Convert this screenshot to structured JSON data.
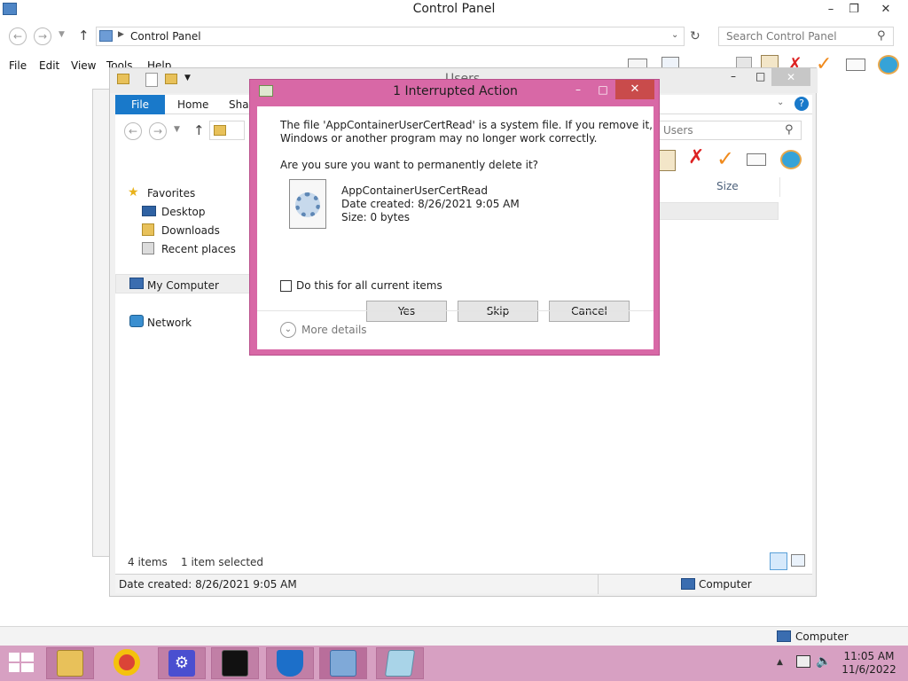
{
  "control_panel": {
    "title": "Control Panel",
    "breadcrumb": "Control Panel",
    "search_placeholder": "Search Control Panel",
    "menu": [
      "File",
      "Edit",
      "View",
      "Tools",
      "Help"
    ]
  },
  "users_window": {
    "title": "Users",
    "ribbon_tabs": [
      "File",
      "Home",
      "Share"
    ],
    "search_placeholder": "Users",
    "column_size": "Size",
    "nav": {
      "favorites": "Favorites",
      "desktop": "Desktop",
      "downloads": "Downloads",
      "recent_places": "Recent places",
      "my_computer": "My Computer",
      "network": "Network"
    },
    "status_items": "4 items",
    "status_selected": "1 item selected",
    "detail_date": "Date created: 8/26/2021 9:05 AM",
    "detail_location": "Computer"
  },
  "dialog": {
    "title": "1 Interrupted Action",
    "message_line1": "The file 'AppContainerUserCertRead' is a system file. If you remove it,",
    "message_line2": "Windows or another program may no longer work correctly.",
    "question": "Are you sure you want to permanently delete it?",
    "file_name": "AppContainerUserCertRead",
    "file_date": "Date created: 8/26/2021 9:05 AM",
    "file_size": "Size: 0 bytes",
    "checkbox_label": "Do this for all current items",
    "checkbox_checked": false,
    "buttons": {
      "yes": "Yes",
      "skip": "Skip",
      "cancel": "Cancel"
    },
    "more_details": "More details"
  },
  "taskbar": {
    "computer_label": "Computer",
    "time": "11:05 AM",
    "date": "11/6/2022",
    "apps": [
      "file-explorer-icon",
      "chrome-icon",
      "settings-icon",
      "command-prompt-icon",
      "security-icon",
      "control-panel-icon",
      "notepad-icon"
    ]
  },
  "colors": {
    "dialog_frame": "#d868a6",
    "taskbar": "#d7a0c2",
    "file_tab": "#1979ca",
    "close_button": "#c94b4b"
  }
}
